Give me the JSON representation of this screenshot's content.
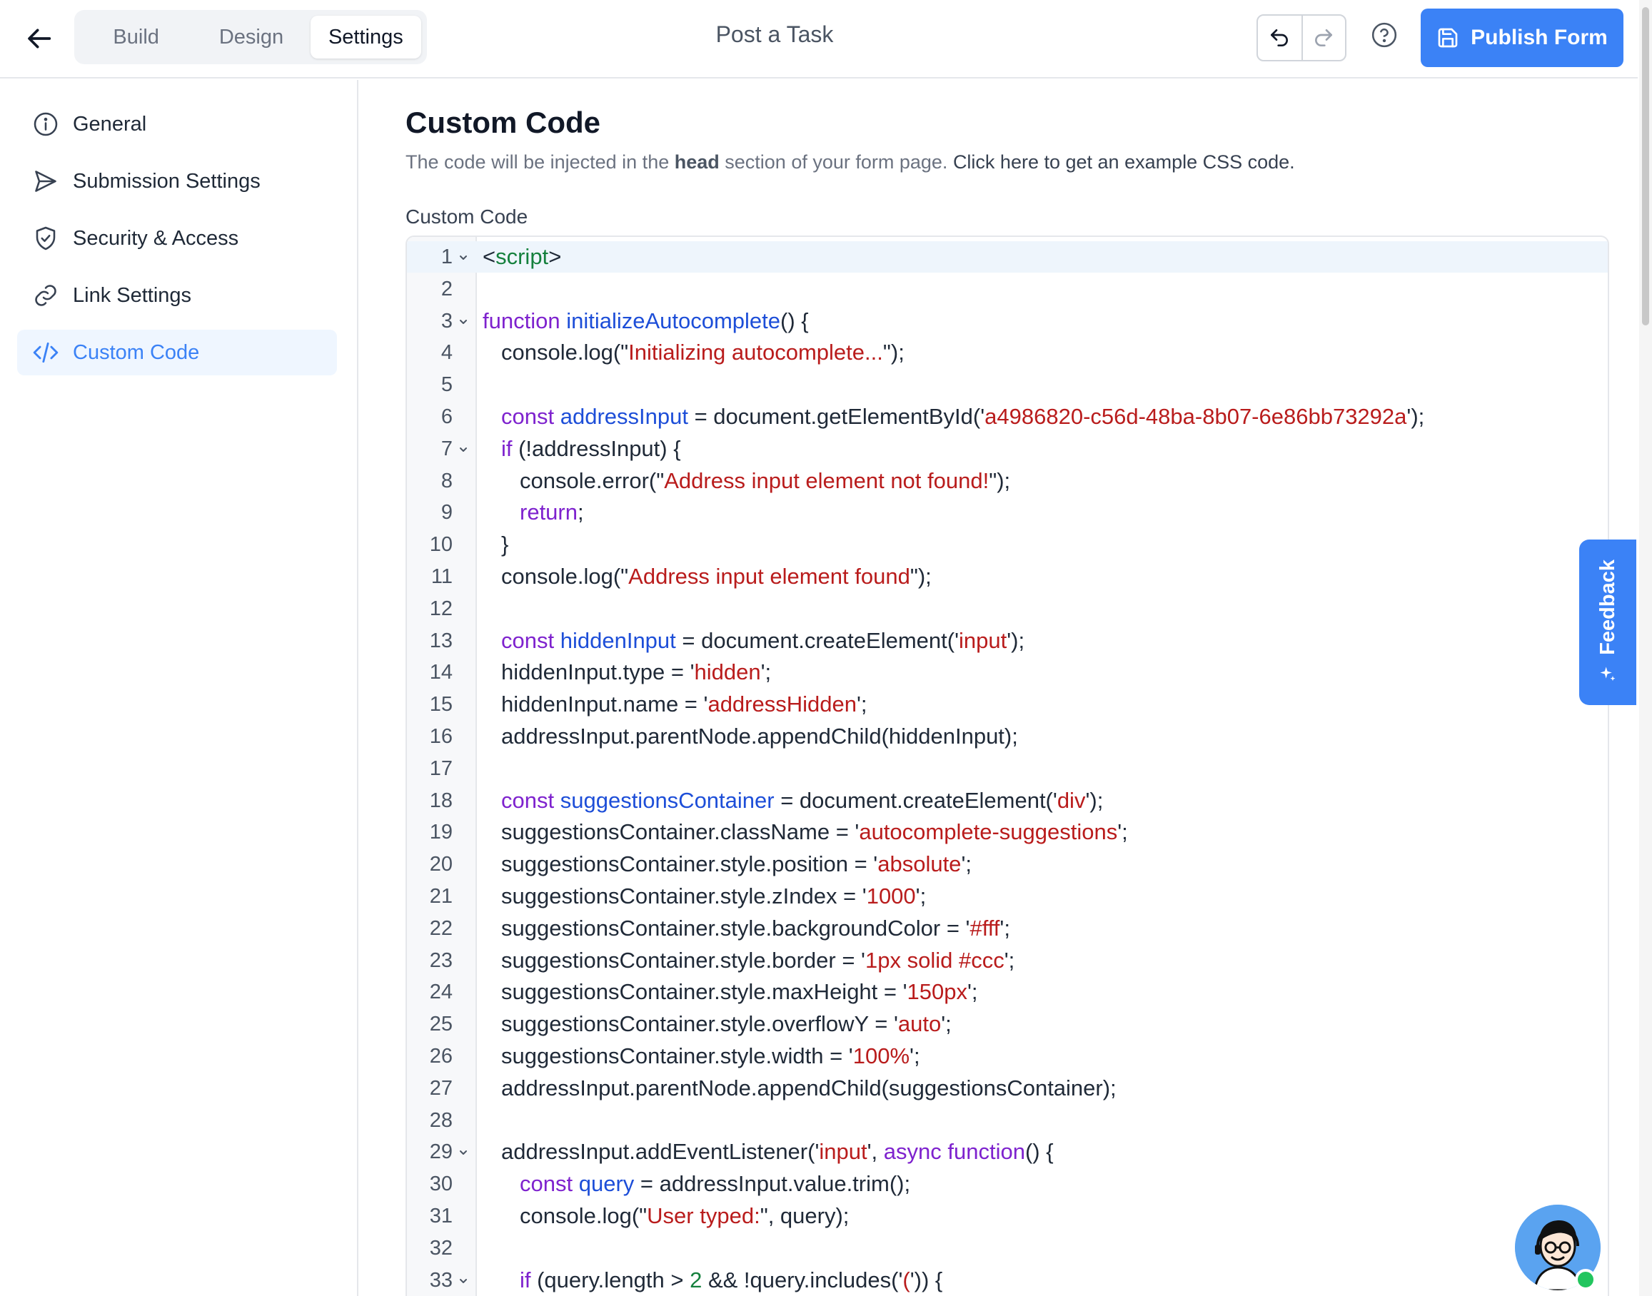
{
  "header": {
    "tabs": [
      "Build",
      "Design",
      "Settings"
    ],
    "active_tab": "Settings",
    "title": "Post a Task",
    "publish_label": "Publish Form"
  },
  "sidebar": {
    "items": [
      {
        "label": "General",
        "icon": "info-circle-icon"
      },
      {
        "label": "Submission Settings",
        "icon": "send-icon"
      },
      {
        "label": "Security & Access",
        "icon": "shield-check-icon"
      },
      {
        "label": "Link Settings",
        "icon": "link-icon"
      },
      {
        "label": "Custom Code",
        "icon": "code-icon"
      }
    ],
    "active": "Custom Code"
  },
  "main": {
    "title": "Custom Code",
    "desc_prefix": "The code will be injected in the ",
    "desc_bold": "head",
    "desc_mid": " section of your form page. ",
    "desc_link": "Click here to get an example CSS code.",
    "field_label": "Custom Code"
  },
  "feedback_label": "Feedback",
  "colors": {
    "accent": "#3b82f6",
    "keyword": "#7e22ce",
    "identifier": "#1d4ed8",
    "string": "#b91c1c",
    "tag": "#15803d"
  },
  "code_lines": [
    "<script>",
    "",
    "function initializeAutocomplete() {",
    "  console.log(\"Initializing autocomplete...\");",
    "",
    "  const addressInput = document.getElementById('a4986820-c56d-48ba-8b07-6e86bb73292a');",
    "  if (!addressInput) {",
    "    console.error(\"Address input element not found!\");",
    "    return;",
    "  }",
    "  console.log(\"Address input element found\");",
    "",
    "  const hiddenInput = document.createElement('input');",
    "  hiddenInput.type = 'hidden';",
    "  hiddenInput.name = 'addressHidden';",
    "  addressInput.parentNode.appendChild(hiddenInput);",
    "",
    "  const suggestionsContainer = document.createElement('div');",
    "  suggestionsContainer.className = 'autocomplete-suggestions';",
    "  suggestionsContainer.style.position = 'absolute';",
    "  suggestionsContainer.style.zIndex = '1000';",
    "  suggestionsContainer.style.backgroundColor = '#fff';",
    "  suggestionsContainer.style.border = '1px solid #ccc';",
    "  suggestionsContainer.style.maxHeight = '150px';",
    "  suggestionsContainer.style.overflowY = 'auto';",
    "  suggestionsContainer.style.width = '100%';",
    "  addressInput.parentNode.appendChild(suggestionsContainer);",
    "",
    "  addressInput.addEventListener('input', async function() {",
    "    const query = addressInput.value.trim();",
    "    console.log(\"User typed:\", query);",
    "",
    "    if (query.length > 2 && !query.includes('(')) {"
  ],
  "fold_lines": [
    1,
    3,
    7,
    29,
    33
  ]
}
